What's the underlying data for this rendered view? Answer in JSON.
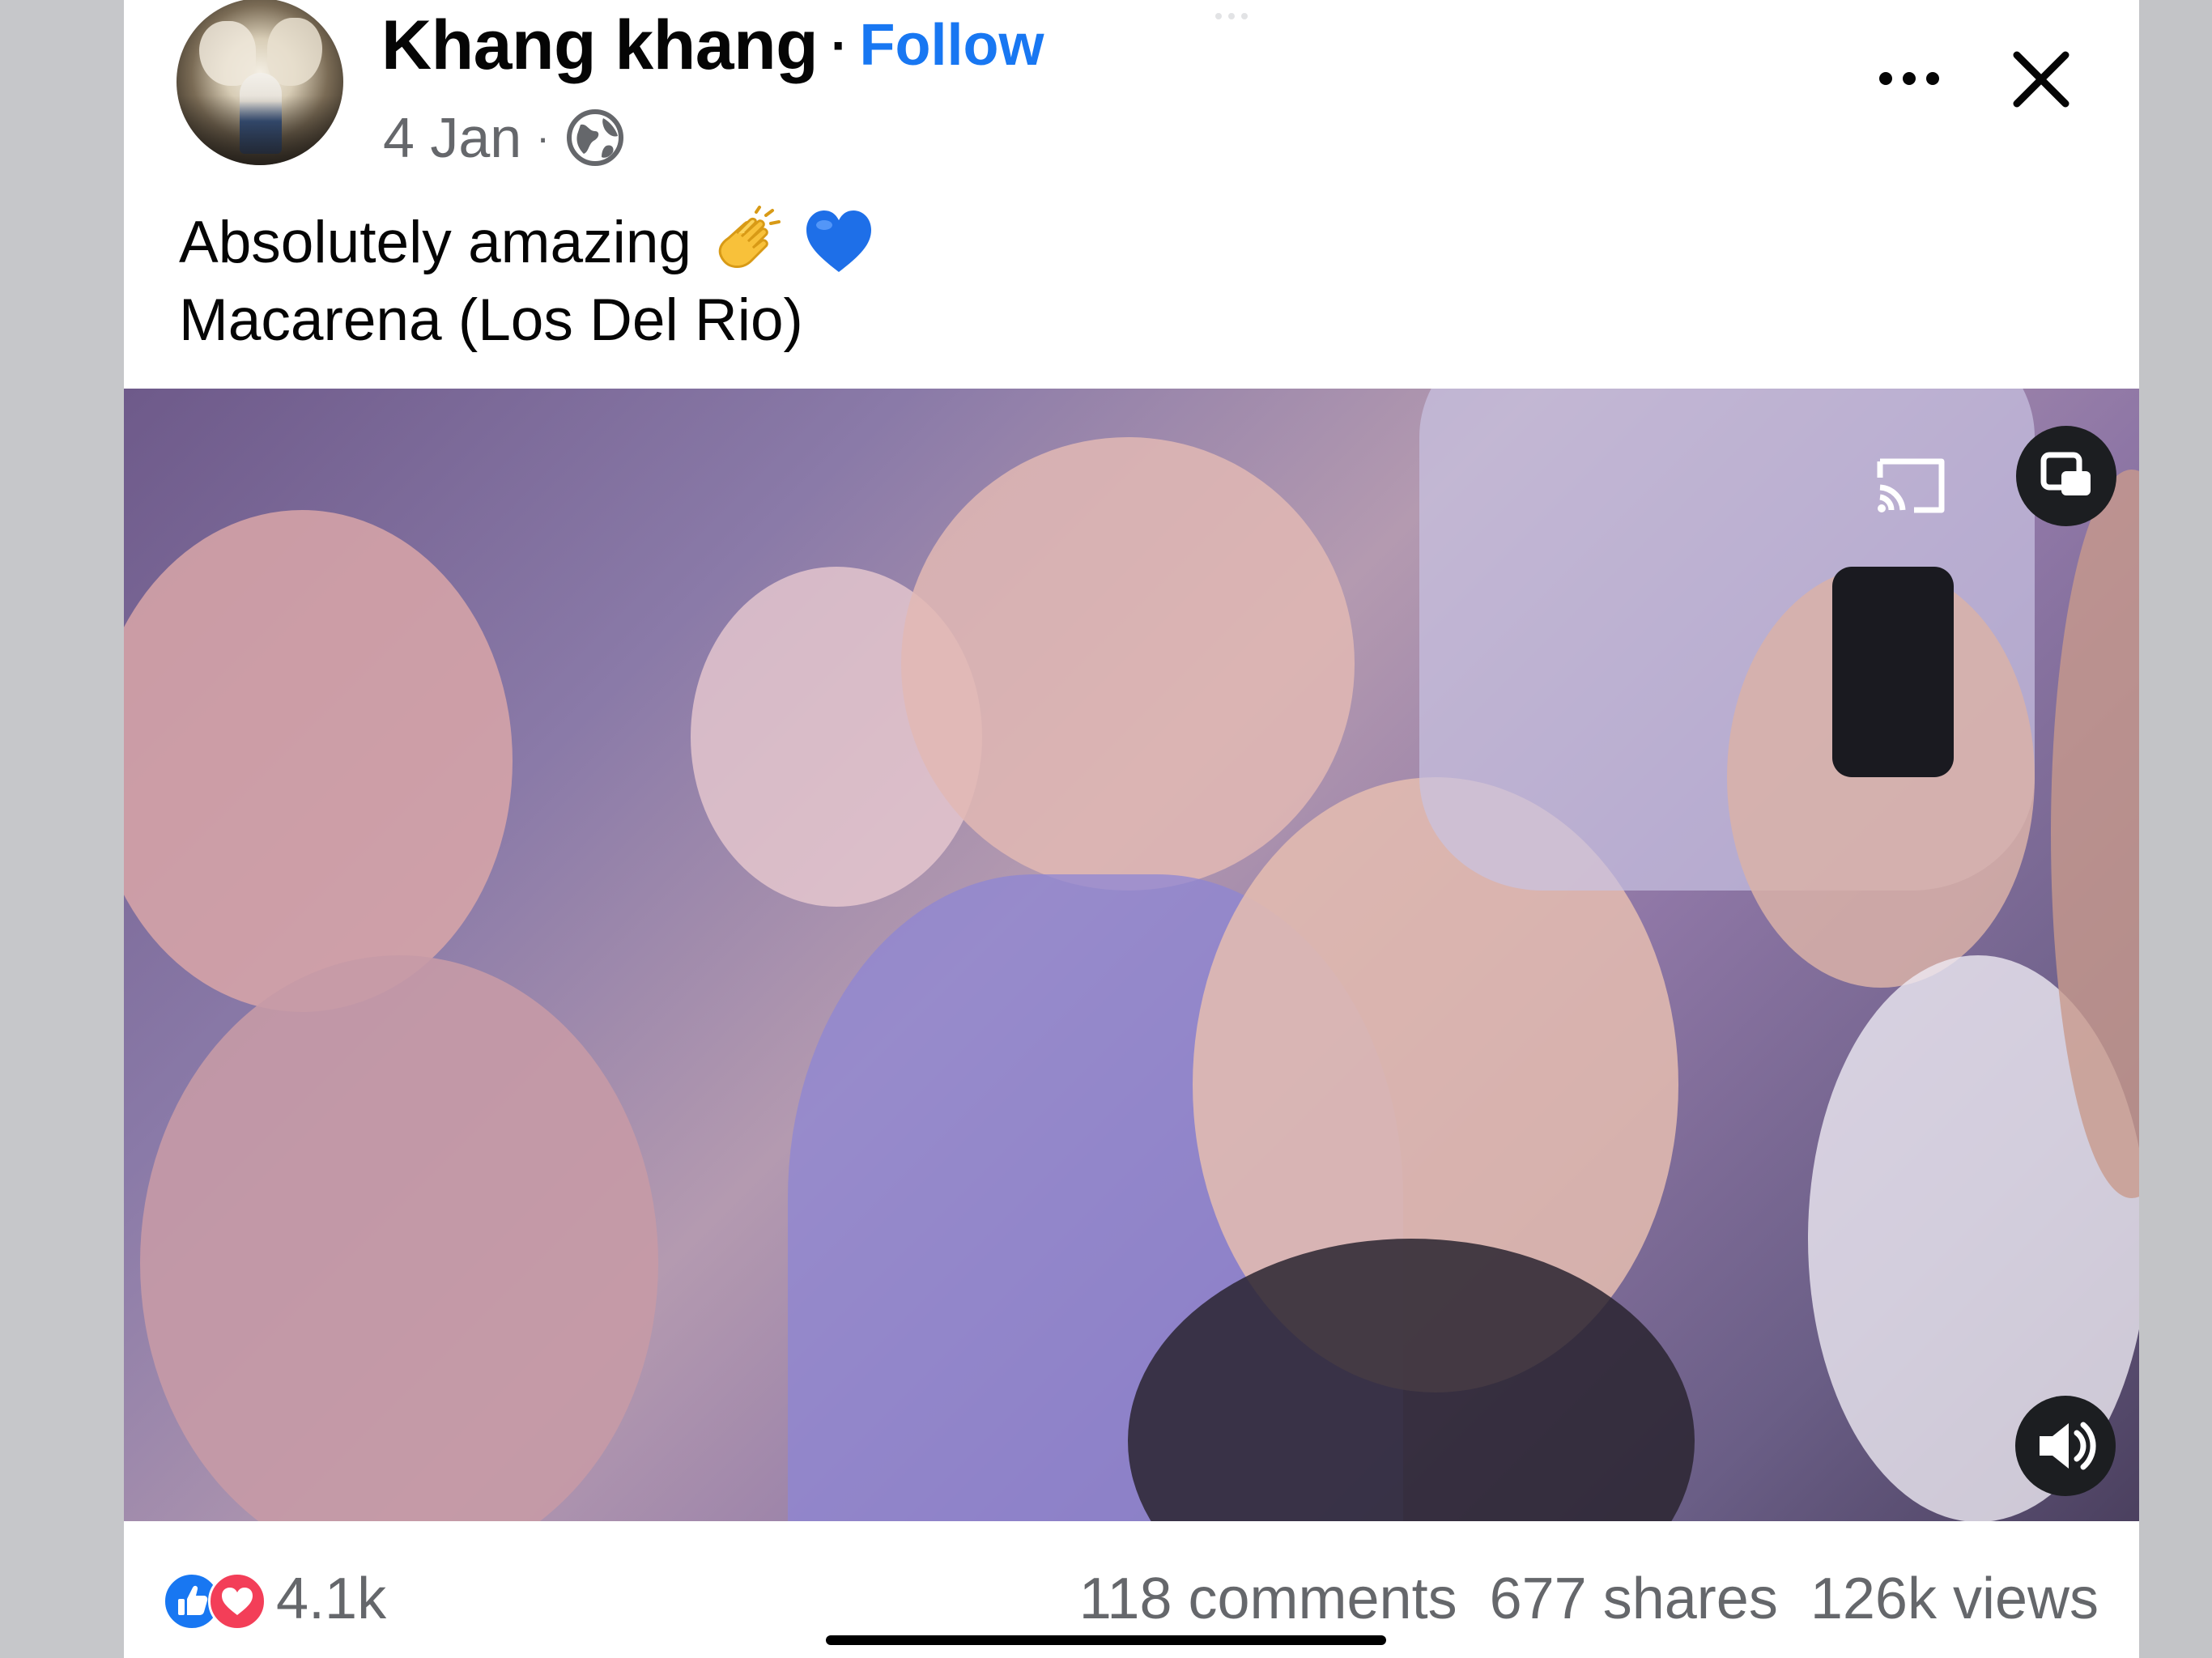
{
  "post": {
    "author": "Khang khang",
    "follow_label": "Follow",
    "date": "4 Jan",
    "privacy_icon": "globe-icon",
    "caption_line1": "Absolutely amazing",
    "caption_emojis": [
      "clapping-hands-emoji",
      "blue-heart-emoji"
    ],
    "caption_line2": "Macarena (Los Del Rio)"
  },
  "header": {
    "more_icon": "more-options-icon",
    "close_icon": "close-icon"
  },
  "video": {
    "cast_icon": "cast-icon",
    "pip_icon": "picture-in-picture-icon",
    "volume_icon": "volume-icon"
  },
  "footer": {
    "reaction_icons": [
      "like-icon",
      "love-icon"
    ],
    "reaction_count": "4.1k",
    "comments": "118 comments",
    "shares": "677 shares",
    "views": "126k views"
  },
  "colors": {
    "follow": "#1877f2",
    "secondary_text": "#65676b",
    "like": "#1877f2",
    "love": "#f33e58"
  }
}
